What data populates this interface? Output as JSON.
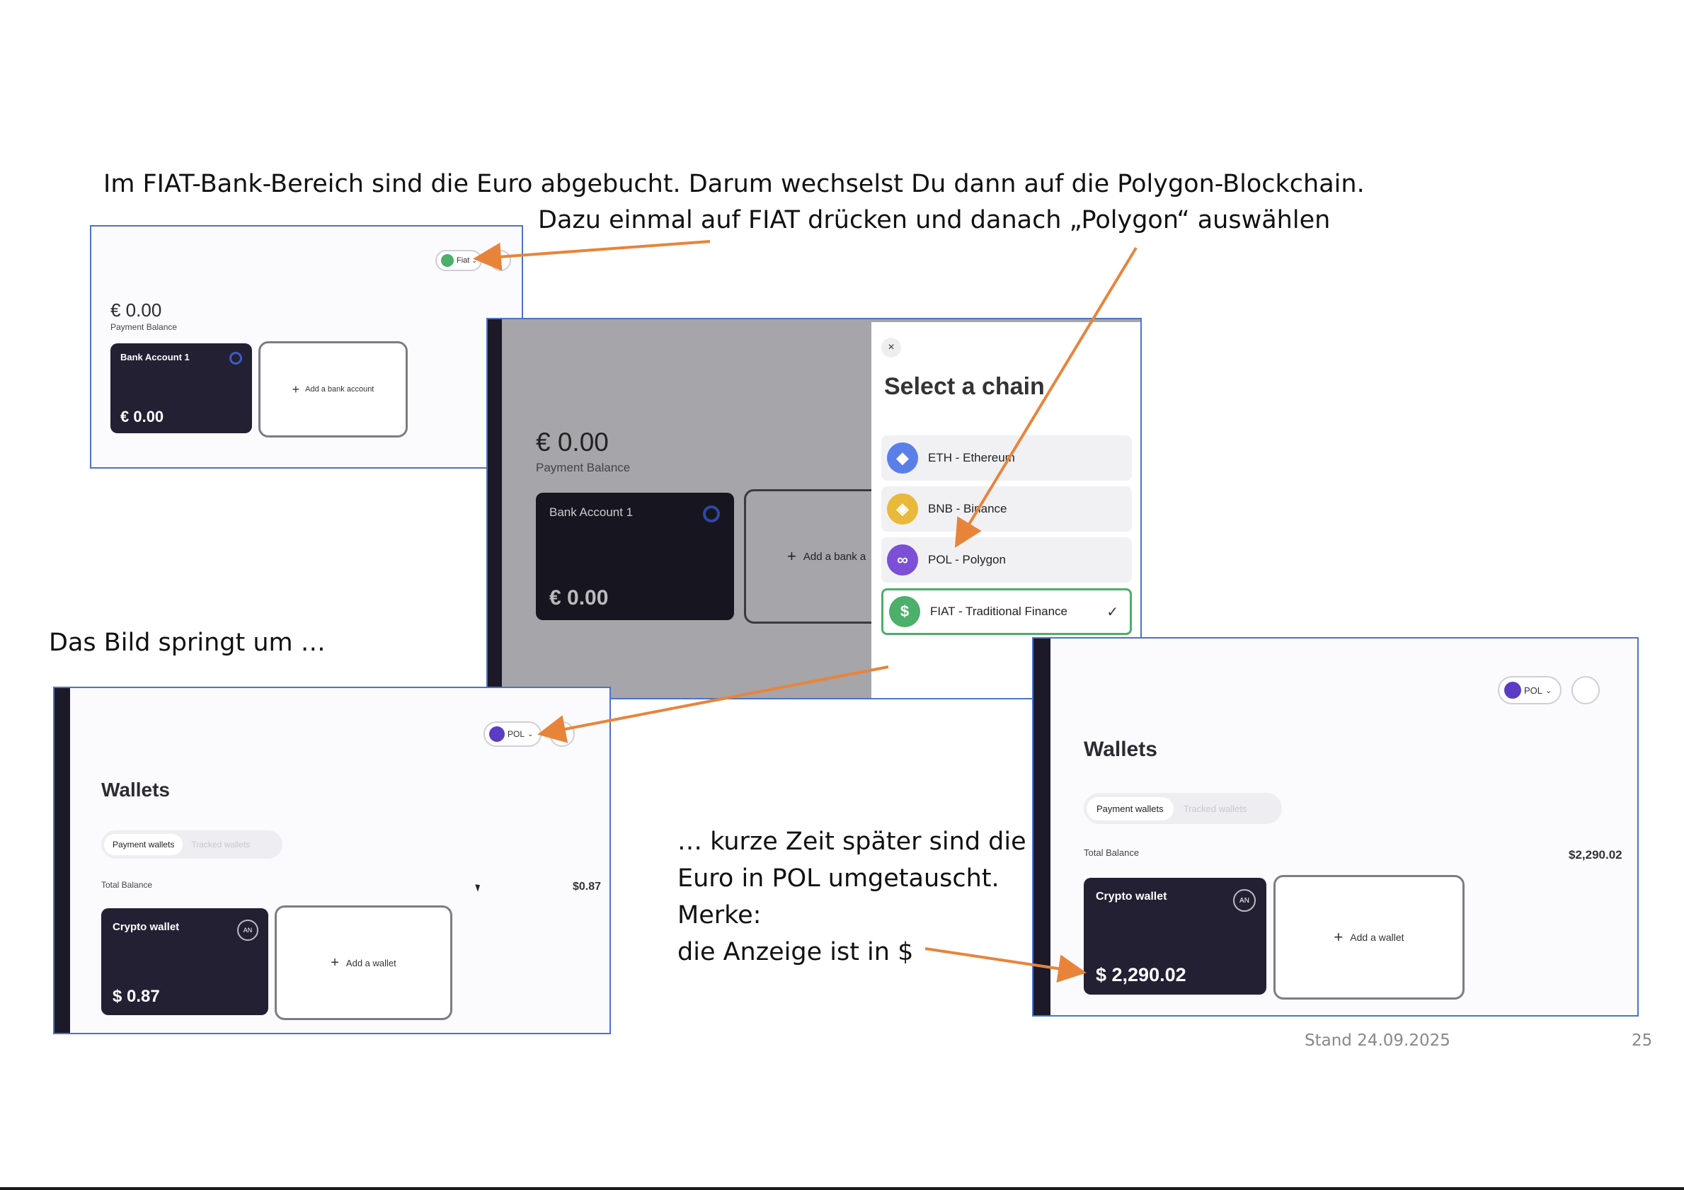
{
  "instructions": {
    "line1": "Im FIAT-Bank-Bereich sind die Euro abgebucht. Darum wechselst Du dann auf die Polygon-Blockchain.",
    "line2": "Dazu einmal auf FIAT drücken und danach „Polygon“ auswählen",
    "jump_note": "Das Bild springt um …",
    "later_note_1": "… kurze Zeit später sind die",
    "later_note_2": "Euro in POL umgetauscht.",
    "later_note_3": "Merke:",
    "later_note_4": "die Anzeige ist in $"
  },
  "footer": {
    "stand": "Stand 24.09.2025",
    "page_number": "25"
  },
  "shot_fiat": {
    "chain_pill": "Fiat",
    "balance": "€ 0.00",
    "balance_label": "Payment Balance",
    "bank_card_title": "Bank Account 1",
    "bank_card_amount": "€ 0.00",
    "add_bank": "Add a bank account"
  },
  "shot_select": {
    "balance": "€ 0.00",
    "balance_label": "Payment Balance",
    "bank_card_title": "Bank Account 1",
    "bank_card_amount": "€ 0.00",
    "add_bank": "Add a bank a",
    "close": "×",
    "title": "Select a chain",
    "chains": [
      {
        "label": "ETH - Ethereum",
        "color": "#5b7fe8",
        "icon": "ethereum-icon",
        "glyph": "◆"
      },
      {
        "label": "BNB - Binance",
        "color": "#e8b93a",
        "icon": "binance-icon",
        "glyph": "◈"
      },
      {
        "label": "POL - Polygon",
        "color": "#7b4fd6",
        "icon": "polygon-icon",
        "glyph": "∞"
      },
      {
        "label": "FIAT - Traditional Finance",
        "color": "#4caf6a",
        "icon": "dollar-icon",
        "glyph": "$"
      }
    ],
    "selected_check": "✓"
  },
  "shot_pol_before": {
    "chain_pill": "POL",
    "title": "Wallets",
    "tab_active": "Payment wallets",
    "tab_inactive": "Tracked wallets",
    "total_label": "Total Balance",
    "total_value": "$0.87",
    "wallet_title": "Crypto wallet",
    "wallet_badge": "AN",
    "wallet_amount": "$ 0.87",
    "add_wallet": "Add a wallet"
  },
  "shot_pol_after": {
    "chain_pill": "POL",
    "title": "Wallets",
    "tab_active": "Payment wallets",
    "tab_inactive": "Tracked wallets",
    "total_label": "Total Balance",
    "total_value": "$2,290.02",
    "wallet_title": "Crypto wallet",
    "wallet_badge": "AN",
    "wallet_amount": "$ 2,290.02",
    "add_wallet": "Add a wallet"
  },
  "colors": {
    "arrow": "#e8843a",
    "frame": "#4b74c4",
    "card": "#232033"
  }
}
